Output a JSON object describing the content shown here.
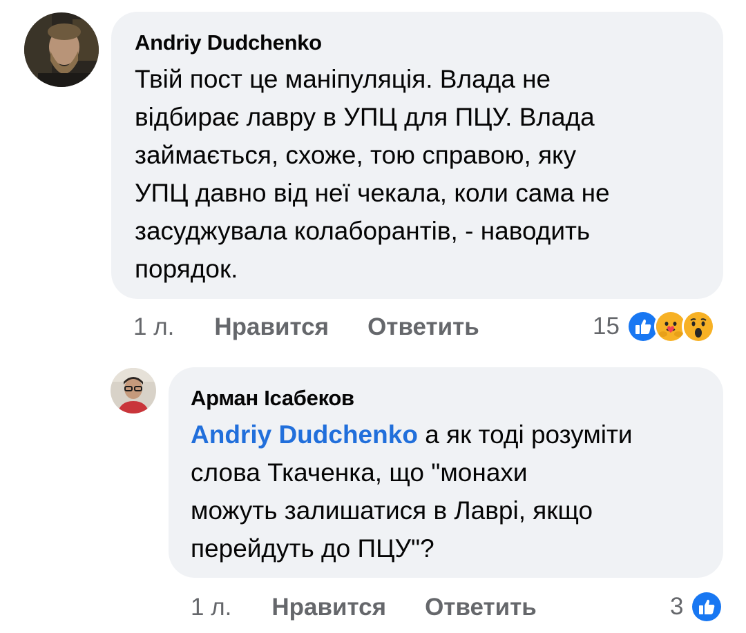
{
  "comments": [
    {
      "author": "Andriy Dudchenko",
      "lines": [
        "Твій пост це маніпуляція. Влада не",
        "відбирає лавру в УПЦ для ПЦУ. Влада",
        "займається, схоже, тою справою, яку",
        "УПЦ давно від неї чекала, коли сама не",
        "засуджувала колаборантів, - наводить",
        "порядок."
      ],
      "time": "1 л.",
      "like_label": "Нравится",
      "reply_label": "Ответить",
      "reaction_count": "15",
      "reactions": [
        "like-icon",
        "care-icon",
        "wow-icon"
      ]
    },
    {
      "author": "Арман Ісабеков",
      "mention": "Andriy Dudchenko",
      "first_line_rest": " а як тоді розуміти",
      "lines": [
        "слова Ткаченка, що \"монахи",
        "можуть залишатися в Лаврі, якщо",
        "перейдуть до ПЦУ\"?"
      ],
      "time": "1 л.",
      "like_label": "Нравится",
      "reply_label": "Ответить",
      "reaction_count": "3",
      "reactions": [
        "like-icon"
      ]
    }
  ],
  "colors": {
    "bubble": "#f0f2f5",
    "mention": "#216fdb",
    "meta": "#65676b",
    "like": "#1877f2"
  }
}
